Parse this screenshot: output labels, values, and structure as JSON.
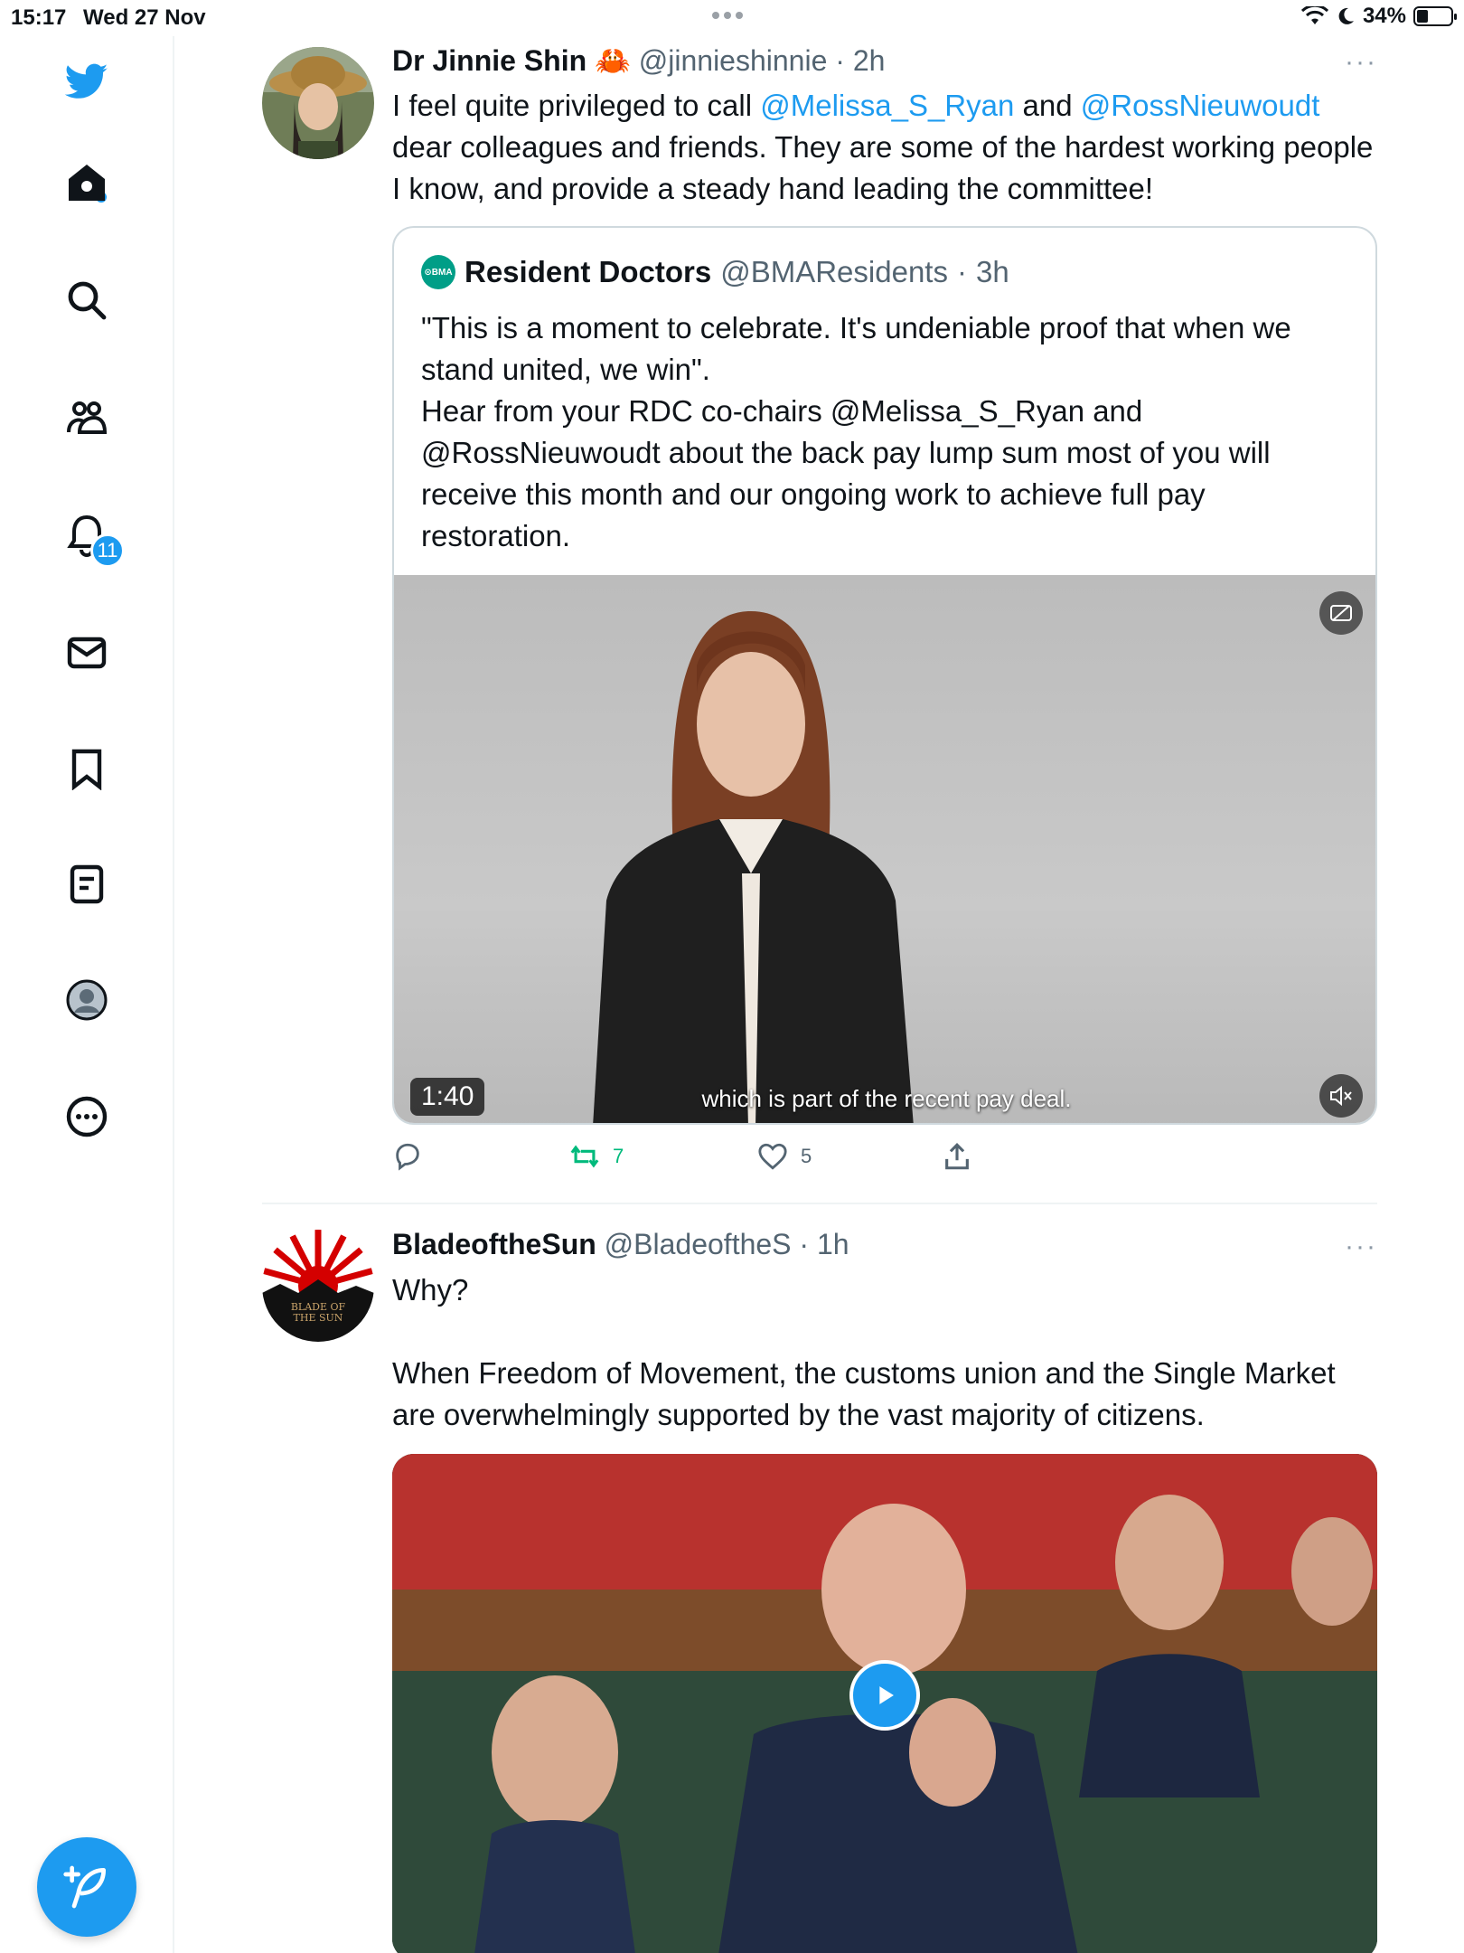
{
  "status_bar": {
    "time": "15:17",
    "date": "Wed 27 Nov",
    "battery": "34%",
    "battery_level": 0.34
  },
  "sidebar": {
    "notifications_badge": "11"
  },
  "tweet1": {
    "name": "Dr Jinnie Shin",
    "name_emoji": "🦀",
    "handle": "@jinnieshinnie",
    "time": "2h",
    "text_1": "I feel quite privileged to call ",
    "mention_1": "@Melissa_S_Ryan",
    "text_2": " and ",
    "mention_2": "@RossNieuwoudt",
    "text_3": " dear colleagues and friends. They are some of the hardest working people I know, and provide a steady hand leading the committee!",
    "quote": {
      "logo": "⊙BMA",
      "name": "Resident Doctors",
      "handle": "@BMAResidents",
      "time": "3h",
      "text": "\"This is a moment to celebrate. It's undeniable proof that when we stand united, we win\".\nHear from your RDC co-chairs @Melissa_S_Ryan and @RossNieuwoudt about the back pay lump sum most of you will receive this month and our ongoing work to achieve full pay restoration.",
      "video_duration": "1:40",
      "video_caption": "which is part of the recent pay deal."
    },
    "actions": {
      "replies": "",
      "retweets": "7",
      "likes": "5"
    }
  },
  "tweet2": {
    "name": "BladeoftheSun",
    "handle": "@BladeoftheS",
    "time": "1h",
    "text": "Why?\n\nWhen Freedom of Movement, the customs union and the Single Market are overwhelmingly supported by the vast majority of citizens.",
    "avatar_text": "BLADE OF THE SUN"
  },
  "colors": {
    "accent": "#1d9bf0",
    "retweet": "#00ba7c",
    "text": "#0f1419",
    "muted": "#536471"
  }
}
